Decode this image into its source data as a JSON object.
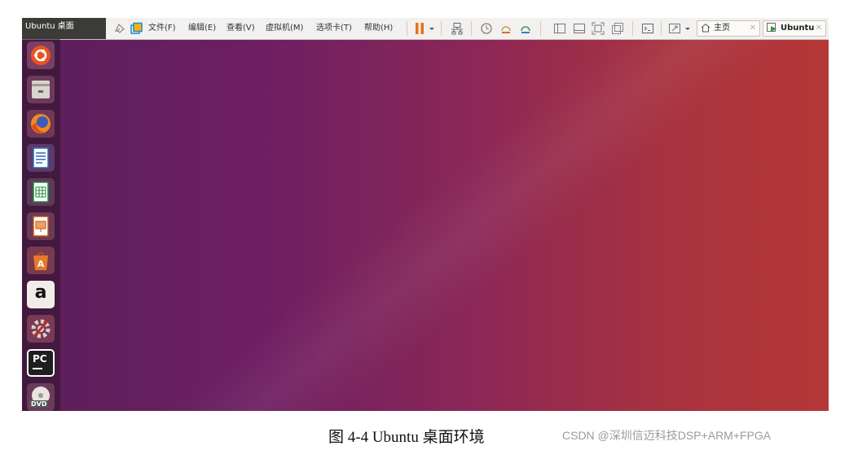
{
  "window": {
    "title": "Ubuntu 桌面"
  },
  "menu": {
    "items": [
      "文件(F)",
      "编辑(E)",
      "查看(V)",
      "虚拟机(M)",
      "选项卡(T)",
      "帮助(H)"
    ]
  },
  "toolbar": {
    "icons": [
      "pin-icon",
      "restore-icon",
      "pause-icon",
      "dropdown-arrow-icon",
      "network-icon",
      "snapshot-icon",
      "revert-snapshot-icon",
      "manage-snapshot-icon",
      "view-sidebar-icon",
      "view-console-icon",
      "fullscreen-icon",
      "unity-icon",
      "terminal-icon",
      "stretch-icon",
      "stretch-dropdown-icon"
    ]
  },
  "tabs": [
    {
      "label": "主页",
      "icon": "home-icon"
    },
    {
      "label": "Ubuntu",
      "icon": "vm-icon"
    }
  ],
  "launcher": {
    "items": [
      "ubuntu-dash-icon",
      "files-icon",
      "firefox-icon",
      "writer-icon",
      "calc-icon",
      "impress-icon",
      "software-center-icon",
      "amazon-icon",
      "system-settings-icon",
      "pycharm-icon",
      "dvd-icon"
    ],
    "amazon_glyph": "a",
    "pycharm_glyph": "PC",
    "dvd_glyph": "DVD"
  },
  "colors": {
    "desktop_left": "#5b1f5a",
    "desktop_right": "#b53838",
    "toolbar_bg": "#f3f1ef",
    "pause_orange": "#e8711a"
  },
  "caption": "图 4-4 Ubuntu 桌面环境",
  "watermark": "CSDN @深圳信迈科技DSP+ARM+FPGA"
}
